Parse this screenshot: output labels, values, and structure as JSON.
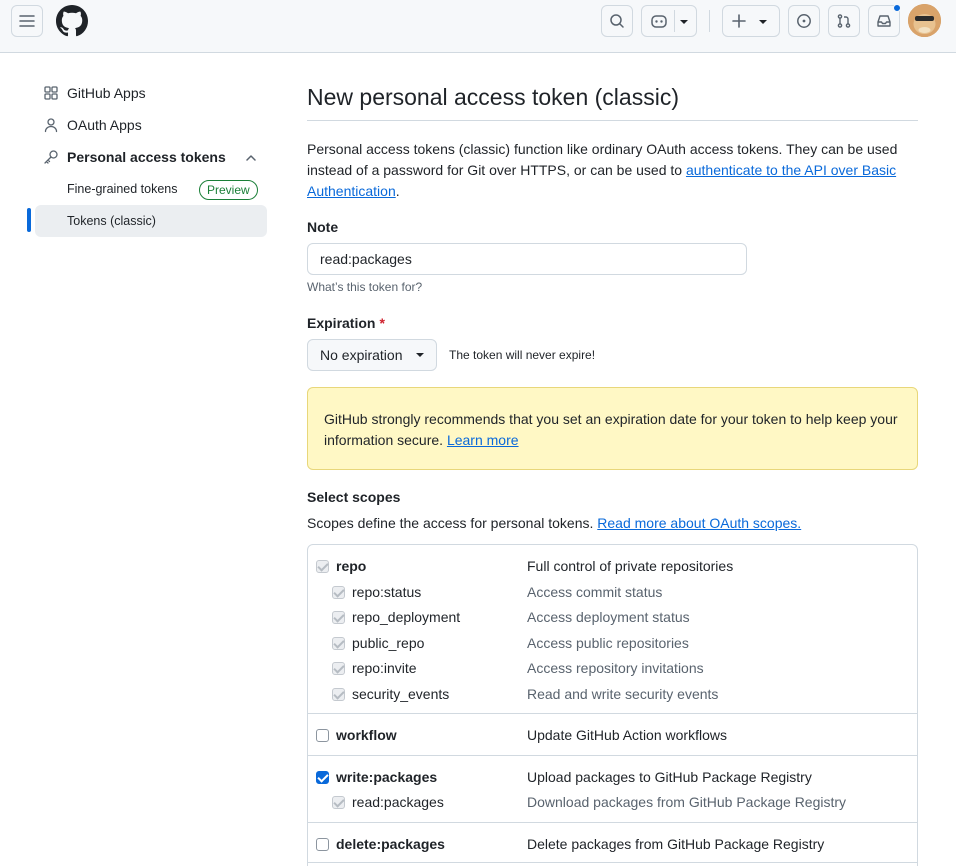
{
  "header": {
    "menu_icon": "hamburger-icon",
    "logo_icon": "github-mark-icon",
    "search_icon": "search-icon",
    "copilot_icon": "copilot-icon",
    "create_icon": "plus-icon",
    "issues_icon": "issue-opened-icon",
    "pulls_icon": "git-pull-request-icon",
    "inbox_icon": "inbox-icon",
    "notification_color": "#0969da"
  },
  "sidebar": {
    "items": [
      {
        "label": "GitHub Apps",
        "icon": "apps-icon"
      },
      {
        "label": "OAuth Apps",
        "icon": "person-icon"
      },
      {
        "label": "Personal access tokens",
        "icon": "key-icon"
      }
    ],
    "sub_items": [
      {
        "label": "Fine-grained tokens",
        "badge": "Preview"
      },
      {
        "label": "Tokens (classic)",
        "active": true
      }
    ]
  },
  "main": {
    "title": "New personal access token (classic)",
    "description": {
      "text": "Personal access tokens (classic) function like ordinary OAuth access tokens. They can be used instead of a password for Git over HTTPS, or can be used to ",
      "link": "authenticate to the API over Basic Authentication",
      "after": "."
    },
    "note": {
      "label": "Note",
      "value": "read:packages",
      "hint": "What’s this token for?"
    },
    "expiration": {
      "label": "Expiration",
      "required_mark": "*",
      "selected": "No expiration",
      "info": "The token will never expire!"
    },
    "warning": {
      "text": "GitHub strongly recommends that you set an expiration date for your token to help keep your information secure. ",
      "link": "Learn more"
    },
    "scopes": {
      "label": "Select scopes",
      "description": "Scopes define the access for personal tokens. ",
      "link": "Read more about OAuth scopes.",
      "groups": [
        {
          "name": "repo",
          "desc": "Full control of private repositories",
          "state": "implied",
          "children": [
            {
              "name": "repo:status",
              "desc": "Access commit status"
            },
            {
              "name": "repo_deployment",
              "desc": "Access deployment status"
            },
            {
              "name": "public_repo",
              "desc": "Access public repositories"
            },
            {
              "name": "repo:invite",
              "desc": "Access repository invitations"
            },
            {
              "name": "security_events",
              "desc": "Read and write security events"
            }
          ]
        },
        {
          "name": "workflow",
          "desc": "Update GitHub Action workflows",
          "state": "unchecked",
          "children": []
        },
        {
          "name": "write:packages",
          "desc": "Upload packages to GitHub Package Registry",
          "state": "checked",
          "children": [
            {
              "name": "read:packages",
              "desc": "Download packages from GitHub Package Registry"
            }
          ]
        },
        {
          "name": "delete:packages",
          "desc": "Delete packages from GitHub Package Registry",
          "state": "unchecked",
          "children": []
        }
      ]
    }
  }
}
